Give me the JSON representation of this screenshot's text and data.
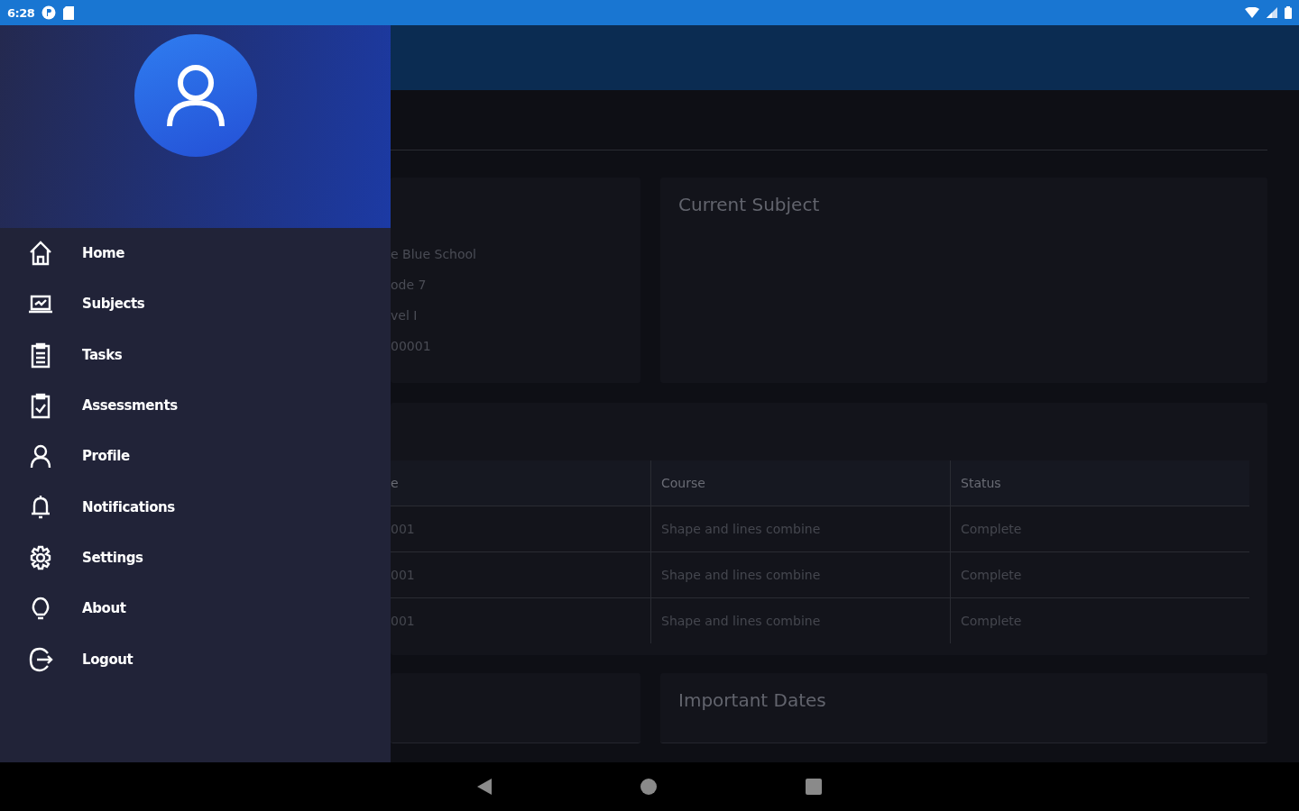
{
  "status_bar": {
    "time": "6:28"
  },
  "drawer": {
    "menu": [
      {
        "label": "Home"
      },
      {
        "label": "Subjects"
      },
      {
        "label": "Tasks"
      },
      {
        "label": "Assessments"
      },
      {
        "label": "Profile"
      },
      {
        "label": "Notifications"
      },
      {
        "label": "Settings"
      },
      {
        "label": "About"
      },
      {
        "label": "Logout"
      }
    ]
  },
  "info_card": {
    "lines": [
      "e Blue School",
      "ode 7",
      "vel I",
      "00001"
    ]
  },
  "current_subject": {
    "title": "Current Subject"
  },
  "table": {
    "columns": [
      "e",
      "Course",
      "Status"
    ],
    "rows": [
      [
        "001",
        "Shape and lines combine",
        "Complete"
      ],
      [
        "001",
        "Shape and lines combine",
        "Complete"
      ],
      [
        "001",
        "Shape and lines combine",
        "Complete"
      ]
    ]
  },
  "important_dates": {
    "title": "Important Dates"
  }
}
